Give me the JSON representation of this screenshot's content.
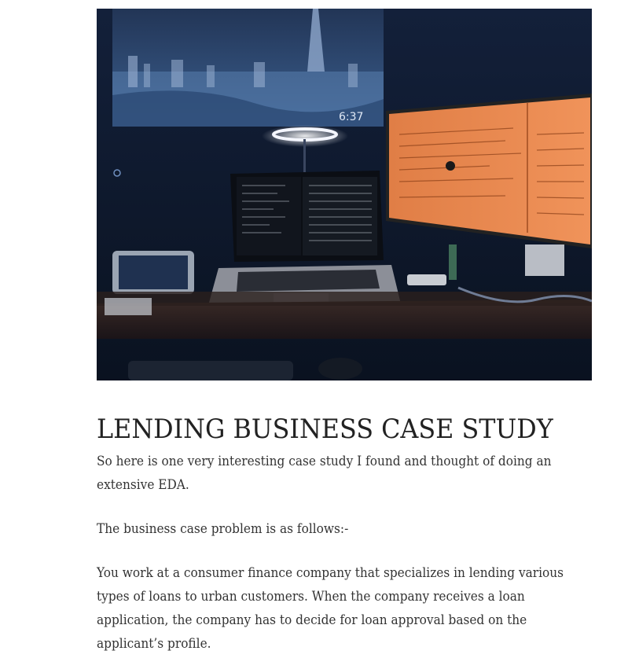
{
  "article": {
    "hero_image": {
      "clock_text": "6:37"
    },
    "title": "LENDING BUSINESS CASE STUDY",
    "paragraphs": [
      "So here is one very interesting case study I found and thought of doing an extensive EDA.",
      "The business case problem is as follows:-",
      "You work at a consumer finance company that specializes in lending various types of loans to urban customers. When the company receives a loan application, the company has to decide for loan approval based on the applicant’s profile."
    ]
  },
  "colors": {
    "background": "#ffffff",
    "title_text": "#222222",
    "body_text": "#333333",
    "monitor_orange": "#e8834a",
    "room_dark": "#0f1a2c"
  }
}
